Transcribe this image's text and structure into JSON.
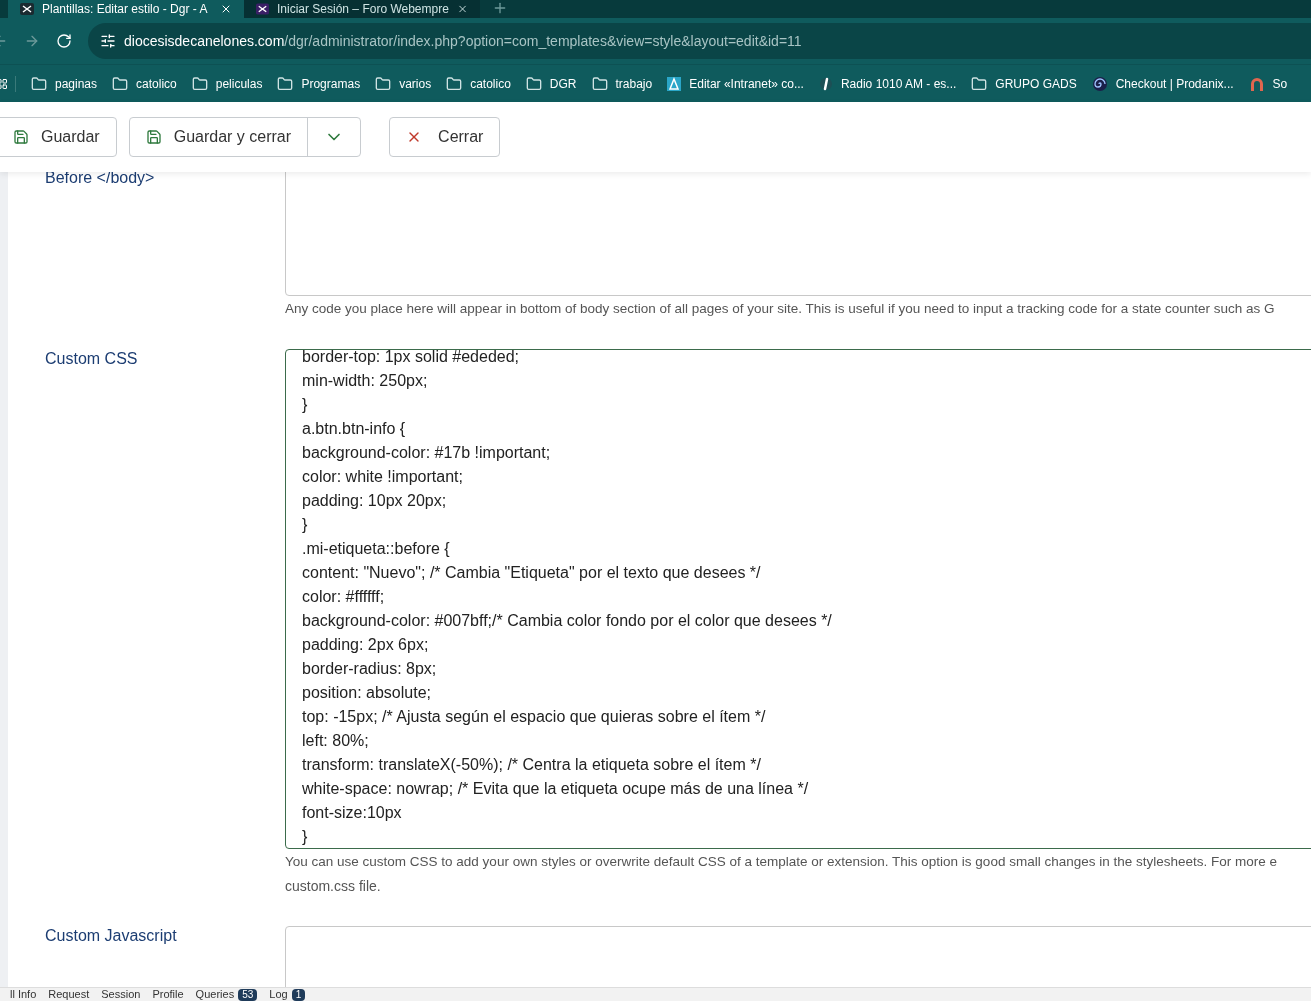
{
  "browser": {
    "tabs": [
      {
        "title": "Plantillas: Editar estilo - Dgr - A",
        "selected": true
      },
      {
        "title": "Iniciar Sesión – Foro Webempre",
        "selected": false
      }
    ],
    "url": {
      "host": "diocesisdecanelones.com",
      "path": "/dgr/administrator/index.php?option=com_templates&view=style&layout=edit&id=11"
    },
    "bookmarks": [
      {
        "label": "paginas",
        "kind": "folder"
      },
      {
        "label": "catolico",
        "kind": "folder"
      },
      {
        "label": "peliculas",
        "kind": "folder"
      },
      {
        "label": "Programas",
        "kind": "folder"
      },
      {
        "label": "varios",
        "kind": "folder"
      },
      {
        "label": "catolico",
        "kind": "folder"
      },
      {
        "label": "DGR",
        "kind": "folder"
      },
      {
        "label": "trabajo",
        "kind": "folder"
      },
      {
        "label": "Editar «Intranet» co...",
        "kind": "triangle"
      },
      {
        "label": "Radio 1010 AM - es...",
        "kind": "mic"
      },
      {
        "label": "GRUPO GADS",
        "kind": "folder"
      },
      {
        "label": "Checkout | Prodanix...",
        "kind": "swirl"
      },
      {
        "label": "So",
        "kind": "arch"
      }
    ]
  },
  "toolbar": {
    "save": "Guardar",
    "save_close": "Guardar y cerrar",
    "close": "Cerrar"
  },
  "fields": [
    {
      "label": "Before </body>",
      "kind": "textarea",
      "help": "Any code you place here will appear in bottom of body section of all pages of your site. This is useful if you need to input a tracking code for a state counter such as G"
    },
    {
      "label": "Custom CSS",
      "kind": "code",
      "lines": [
        "border-top: 1px solid #ededed;",
        "min-width: 250px;",
        "}",
        "a.btn.btn-info {",
        "background-color: #17b !important;",
        "color: white !important;",
        "padding: 10px 20px;",
        "}",
        ".mi-etiqueta::before {",
        "content: \"Nuevo\"; /* Cambia \"Etiqueta\" por el texto que desees */",
        "color: #ffffff;",
        "background-color: #007bff;/* Cambia color fondo por el color que desees */",
        "padding: 2px 6px;",
        "border-radius: 8px;",
        "position: absolute;",
        "top: -15px; /* Ajusta según el espacio que quieras sobre el ítem */",
        "left: 80%;",
        "transform: translateX(-50%); /* Centra la etiqueta sobre el ítem */",
        "white-space: nowrap; /* Evita que la etiqueta ocupe más de una línea */",
        "font-size:10px",
        "}"
      ],
      "help": "You can use custom CSS to add your own styles or overwrite default CSS of a template or extension. This option is good small changes in the stylesheets. For more e",
      "help_2": "custom.css file."
    },
    {
      "label": "Custom Javascript",
      "kind": "textarea"
    }
  ],
  "debug_bar": [
    {
      "label": "ll Info"
    },
    {
      "label": "Request"
    },
    {
      "label": "Session"
    },
    {
      "label": "Profile"
    },
    {
      "label": "Queries",
      "badge": "53"
    },
    {
      "label": "Log",
      "badge": "1"
    }
  ]
}
